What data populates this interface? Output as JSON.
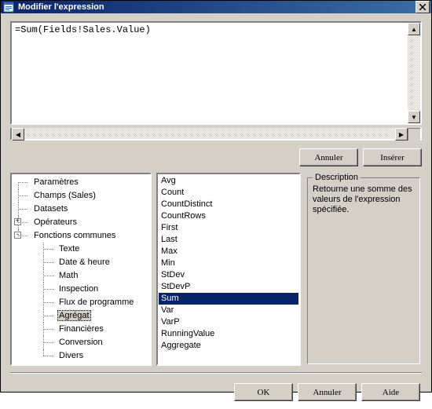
{
  "window": {
    "title": "Modifier l'expression"
  },
  "expression": {
    "value": "=Sum(Fields!Sales.Value)"
  },
  "buttons": {
    "cancel_top": "Annuler",
    "insert": "Insérer",
    "ok": "OK",
    "cancel_bottom": "Annuler",
    "help": "Aide"
  },
  "tree": {
    "items": [
      {
        "label": "Paramètres",
        "expand": null
      },
      {
        "label": "Champs (Sales)",
        "expand": null
      },
      {
        "label": "Datasets",
        "expand": null
      },
      {
        "label": "Opérateurs",
        "expand": "plus"
      },
      {
        "label": "Fonctions communes",
        "expand": "minus",
        "children": [
          {
            "label": "Texte"
          },
          {
            "label": "Date & heure"
          },
          {
            "label": "Math"
          },
          {
            "label": "Inspection"
          },
          {
            "label": "Flux de programme"
          },
          {
            "label": "Agrégat",
            "selected": true
          },
          {
            "label": "Financières"
          },
          {
            "label": "Conversion"
          },
          {
            "label": "Divers"
          }
        ]
      }
    ]
  },
  "functions": {
    "items": [
      "Avg",
      "Count",
      "CountDistinct",
      "CountRows",
      "First",
      "Last",
      "Max",
      "Min",
      "StDev",
      "StDevP",
      "Sum",
      "Var",
      "VarP",
      "RunningValue",
      "Aggregate"
    ],
    "selected": "Sum"
  },
  "description": {
    "legend": "Description",
    "text": "Retourne une somme des valeurs de l'expression spécifiée."
  }
}
